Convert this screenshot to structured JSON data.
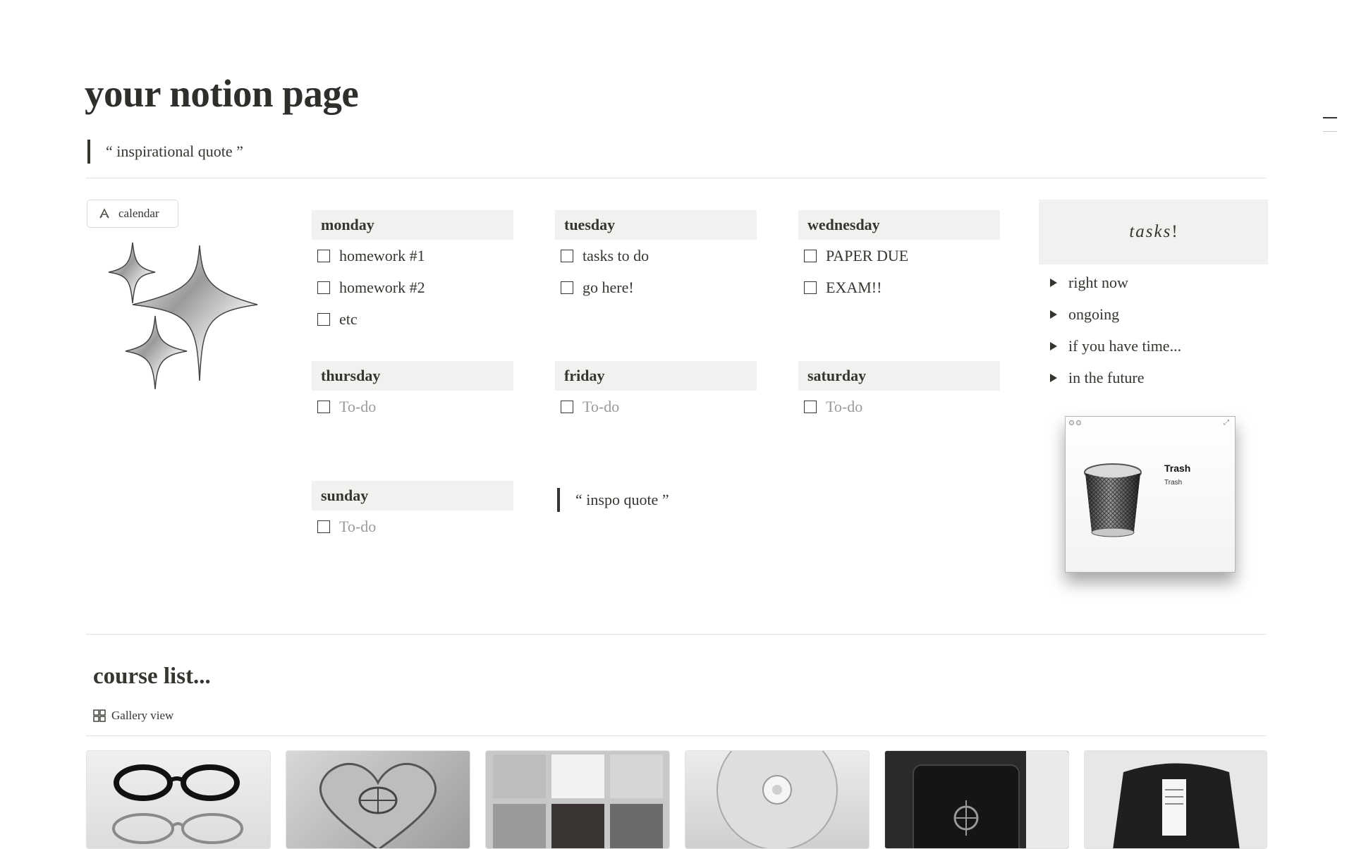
{
  "page": {
    "title": "your notion page",
    "quote": "“ inspirational quote ”"
  },
  "calendar_button": {
    "label": "calendar",
    "icon": "notion-calendar-icon"
  },
  "days": [
    {
      "name": "monday",
      "items": [
        {
          "text": "homework #1",
          "placeholder": false
        },
        {
          "text": "homework #2",
          "placeholder": false
        },
        {
          "text": "etc",
          "placeholder": false
        }
      ]
    },
    {
      "name": "tuesday",
      "items": [
        {
          "text": "tasks to do",
          "placeholder": false
        },
        {
          "text": "go here!",
          "placeholder": false
        }
      ]
    },
    {
      "name": "wednesday",
      "items": [
        {
          "text": "PAPER DUE",
          "placeholder": false
        },
        {
          "text": "EXAM!!",
          "placeholder": false
        }
      ]
    },
    {
      "name": "thursday",
      "items": [
        {
          "text": "To-do",
          "placeholder": true
        }
      ]
    },
    {
      "name": "friday",
      "items": [
        {
          "text": "To-do",
          "placeholder": true
        }
      ]
    },
    {
      "name": "saturday",
      "items": [
        {
          "text": "To-do",
          "placeholder": true
        }
      ]
    },
    {
      "name": "sunday",
      "items": [
        {
          "text": "To-do",
          "placeholder": true
        }
      ]
    }
  ],
  "inspo_quote": "“ inspo quote ”",
  "tasks": {
    "title_italic": "tasks",
    "title_suffix": "!",
    "toggles": [
      "right now",
      "ongoing",
      "if you have time...",
      "in the future"
    ]
  },
  "trash_widget": {
    "title": "Trash",
    "subtitle": "Trash"
  },
  "course_list": {
    "heading": "course list...",
    "view_label": "Gallery view",
    "cards": [
      "glasses",
      "heart-compact",
      "eyeshadow-palette",
      "cd-disc",
      "leather-wallet",
      "fuzzy-bag"
    ]
  },
  "colors": {
    "text": "#37352f",
    "block_bg": "#f1f1ef",
    "divider": "#e3e2e0",
    "placeholder": "#9b9a97"
  }
}
